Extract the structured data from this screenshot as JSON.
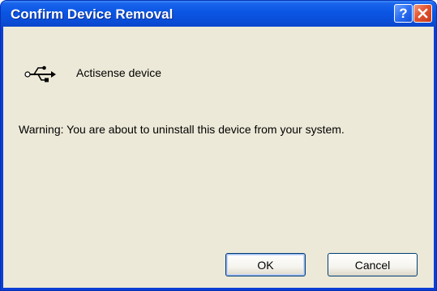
{
  "window": {
    "title": "Confirm Device Removal",
    "help_glyph": "?",
    "title_bar_color": "#0a4fd9",
    "client_bg_color": "#ece9d8"
  },
  "device": {
    "icon": "usb-icon",
    "name": "Actisense device"
  },
  "message": {
    "warning": "Warning: You are about to uninstall this device from your system."
  },
  "buttons": {
    "ok_label": "OK",
    "cancel_label": "Cancel"
  }
}
